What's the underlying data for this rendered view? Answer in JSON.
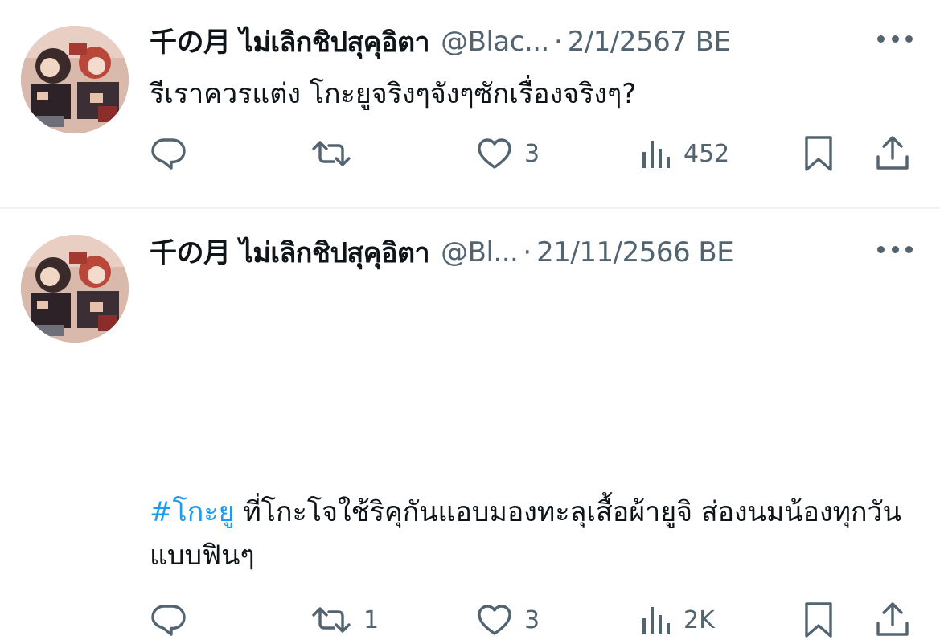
{
  "colors": {
    "text_primary": "#0f1419",
    "text_secondary": "#536471",
    "hashtag": "#1d9bf0",
    "divider": "#eff3f4"
  },
  "icons": [
    "reply-icon",
    "retweet-icon",
    "like-icon",
    "views-icon",
    "bookmark-icon",
    "share-icon",
    "more-icon"
  ],
  "tweets": [
    {
      "name": "千の月 ไม่เลิกชิปสุคุอิตา",
      "handle": "@Blac...",
      "separator": "·",
      "date": "2/1/2567 BE",
      "hashtag": "",
      "text": "รีเราควรแต่ง โกะยูจริงๆจังๆซักเรื่องจริงๆ?",
      "replies": "",
      "retweets": "",
      "likes": "3",
      "views": "452"
    },
    {
      "name": "千の月 ไม่เลิกชิปสุคุอิตา",
      "handle": "@Bl...",
      "separator": "·",
      "date": "21/11/2566 BE",
      "hashtag": "#โกะยู",
      "text": " ที่โกะโจใช้ริคุกันแอบมองทะลุเสื้อผ้ายูจิ ส่องนมน้องทุกวันแบบฟินๆ",
      "replies": "",
      "retweets": "1",
      "likes": "3",
      "views": "2K"
    }
  ]
}
